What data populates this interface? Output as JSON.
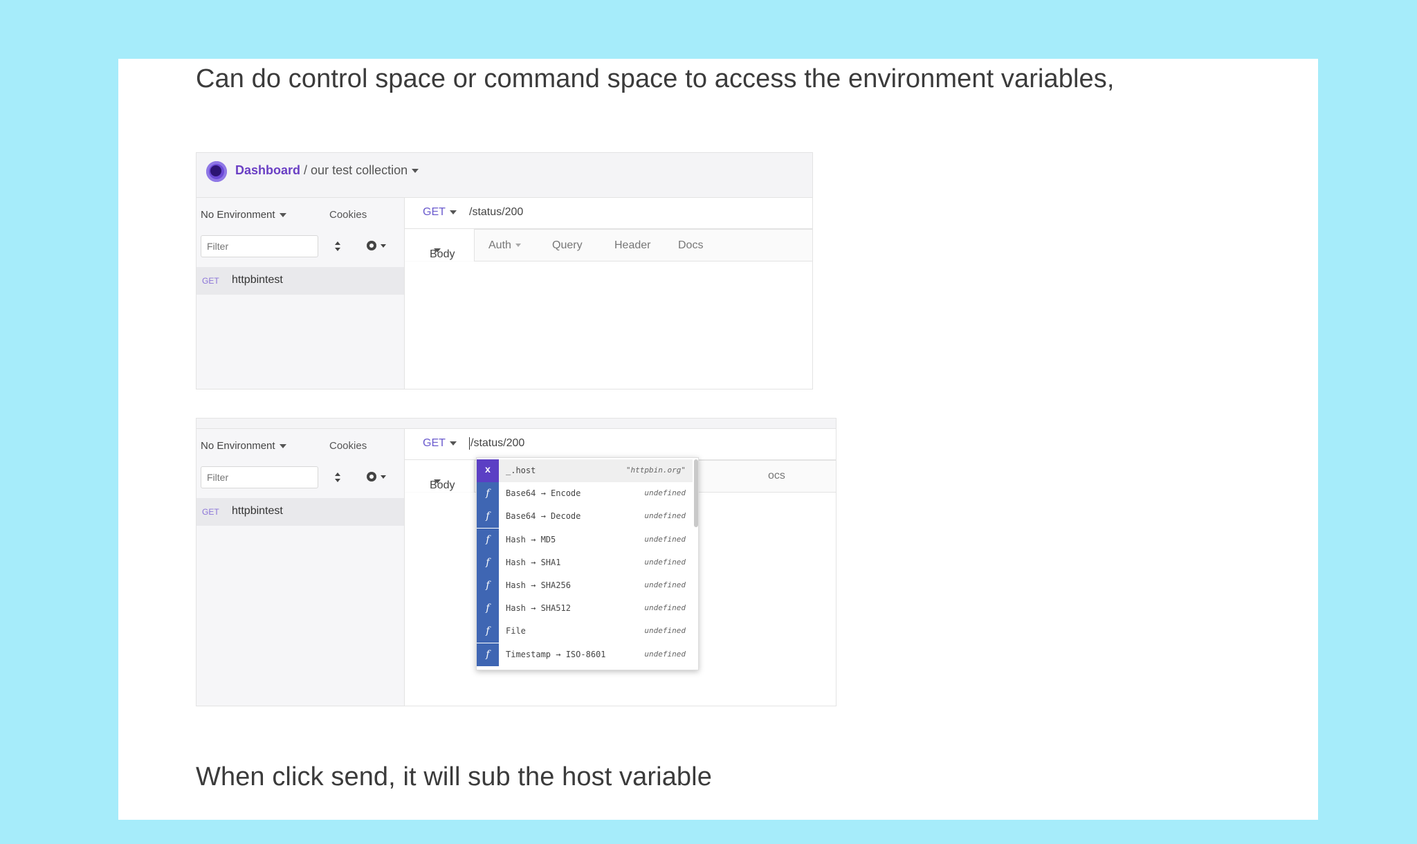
{
  "notes": {
    "top": "Can do control space or command space to access the environment variables,",
    "bottom": "When click send, it will sub the host variable"
  },
  "screenshot1": {
    "breadcrumb": {
      "dashboard": "Dashboard",
      "separator": " / ",
      "collection": "our test collection"
    },
    "sidebar": {
      "environment": "No Environment",
      "cookies": "Cookies",
      "filter_placeholder": "Filter",
      "request": {
        "method": "GET",
        "name": "httpbintest"
      }
    },
    "request": {
      "method": "GET",
      "url": "/status/200"
    },
    "tabs": {
      "body": "Body",
      "auth": "Auth",
      "query": "Query",
      "header": "Header",
      "docs": "Docs"
    }
  },
  "screenshot2": {
    "sidebar": {
      "environment": "No Environment",
      "cookies": "Cookies",
      "filter_placeholder": "Filter",
      "request": {
        "method": "GET",
        "name": "httpbintest"
      }
    },
    "request": {
      "method": "GET",
      "url": "/status/200"
    },
    "tabs": {
      "body": "Body",
      "docs_partial": "ocs"
    },
    "autocomplete": [
      {
        "badge": "x",
        "name": "_.host",
        "value": "\"httpbin.org\""
      },
      {
        "badge": "f",
        "name": "Base64 → Encode",
        "value": "undefined"
      },
      {
        "badge": "f",
        "name": "Base64 → Decode",
        "value": "undefined"
      },
      {
        "badge": "f",
        "name": "Hash → MD5",
        "value": "undefined"
      },
      {
        "badge": "f",
        "name": "Hash → SHA1",
        "value": "undefined"
      },
      {
        "badge": "f",
        "name": "Hash → SHA256",
        "value": "undefined"
      },
      {
        "badge": "f",
        "name": "Hash → SHA512",
        "value": "undefined"
      },
      {
        "badge": "f",
        "name": "File",
        "value": "undefined"
      },
      {
        "badge": "f",
        "name": "Timestamp → ISO-8601",
        "value": "undefined"
      }
    ]
  },
  "colors": {
    "background": "#a6ecfa",
    "accent": "#6a3fc4",
    "function_badge": "#3f66b3",
    "variable_badge": "#5b3fc4"
  }
}
